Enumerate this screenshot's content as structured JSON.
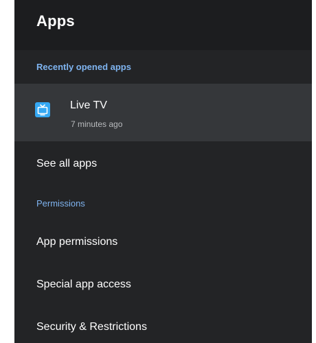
{
  "header": {
    "title": "Apps"
  },
  "sections": {
    "recent_label": "Recently opened apps",
    "permissions_label": "Permissions"
  },
  "recent_apps": [
    {
      "name": "Live TV",
      "subtitle": "7 minutes ago",
      "icon": "tv-icon"
    }
  ],
  "menu": {
    "see_all": "See all apps",
    "app_permissions": "App permissions",
    "special_access": "Special app access",
    "security": "Security & Restrictions"
  },
  "colors": {
    "panel_bg": "#232426",
    "header_bg": "#1c1d1f",
    "selected_row_bg": "#35373a",
    "section_accent": "#7fb4f0",
    "icon_bg": "#35a8f3"
  }
}
